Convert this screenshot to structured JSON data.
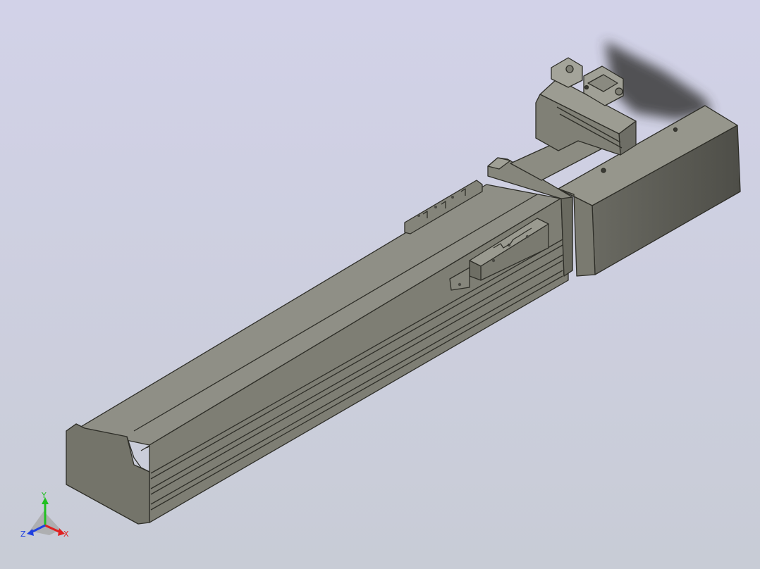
{
  "viewport": {
    "background_top": "#d2d2e8",
    "background_bottom": "#c8ccd6"
  },
  "model": {
    "colors": {
      "top": "#8f8f86",
      "side": "#7e7e74",
      "end": "#74746a",
      "edge": "#2e2e28",
      "shadow": "#404040"
    }
  },
  "triad": {
    "x_label": "X",
    "y_label": "Y",
    "z_label": "Z",
    "x_color": "#e02020",
    "y_color": "#20c020",
    "z_color": "#2040e0"
  }
}
